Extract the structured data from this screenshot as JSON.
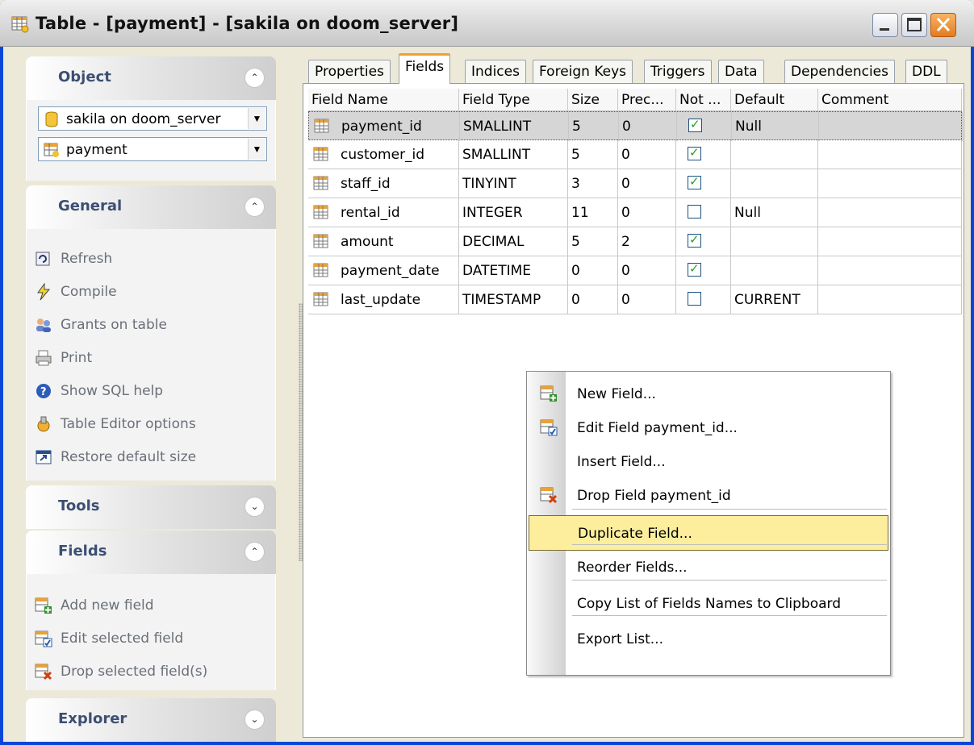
{
  "window": {
    "title": "Table - [payment] - [sakila on doom_server]",
    "buttons": [
      "minimize-icon",
      "maximize-icon",
      "close-icon"
    ]
  },
  "sidebar": {
    "object_label": "Object",
    "database_combo": "sakila on doom_server",
    "table_combo": "payment",
    "general_label": "General",
    "general_items": [
      "Refresh",
      "Compile",
      "Grants on table",
      "Print",
      "Show SQL help",
      "Table Editor options",
      "Restore default size"
    ],
    "tools_label": "Tools",
    "fields_label": "Fields",
    "fields_items": [
      "Add new field",
      "Edit selected field",
      "Drop selected field(s)"
    ],
    "explorer_label": "Explorer"
  },
  "tabs": [
    "Properties",
    "Fields",
    "Indices",
    "Foreign Keys",
    "Triggers",
    "Data",
    "Dependencies",
    "DDL"
  ],
  "active_tab": "Fields",
  "grid": {
    "columns": [
      "Field Name",
      "Field Type",
      "Size",
      "Prec...",
      "Not ...",
      "Default",
      "Comment"
    ],
    "rows": [
      {
        "name": "payment_id",
        "type": "SMALLINT",
        "size": "5",
        "prec": "0",
        "not_null": true,
        "default": "Null",
        "comment": ""
      },
      {
        "name": "customer_id",
        "type": "SMALLINT",
        "size": "5",
        "prec": "0",
        "not_null": true,
        "default": "",
        "comment": ""
      },
      {
        "name": "staff_id",
        "type": "TINYINT",
        "size": "3",
        "prec": "0",
        "not_null": true,
        "default": "",
        "comment": ""
      },
      {
        "name": "rental_id",
        "type": "INTEGER",
        "size": "11",
        "prec": "0",
        "not_null": false,
        "default": "Null",
        "comment": ""
      },
      {
        "name": "amount",
        "type": "DECIMAL",
        "size": "5",
        "prec": "2",
        "not_null": true,
        "default": "",
        "comment": ""
      },
      {
        "name": "payment_date",
        "type": "DATETIME",
        "size": "0",
        "prec": "0",
        "not_null": true,
        "default": "",
        "comment": ""
      },
      {
        "name": "last_update",
        "type": "TIMESTAMP",
        "size": "0",
        "prec": "0",
        "not_null": false,
        "default": "CURRENT",
        "comment": ""
      }
    ]
  },
  "context_menu": {
    "items": [
      {
        "label": "New Field...",
        "icon": "new-field-icon"
      },
      {
        "label": "Edit Field payment_id...",
        "icon": "edit-field-icon"
      },
      {
        "label": "Insert Field...",
        "icon": ""
      },
      {
        "label": "Drop Field payment_id",
        "icon": "drop-field-icon"
      },
      {
        "label": "Duplicate Field...",
        "icon": "",
        "highlighted": true
      },
      {
        "label": "Reorder Fields...",
        "icon": ""
      },
      {
        "label": "Copy List of Fields Names to Clipboard",
        "icon": ""
      },
      {
        "label": "Export List...",
        "icon": ""
      }
    ]
  }
}
